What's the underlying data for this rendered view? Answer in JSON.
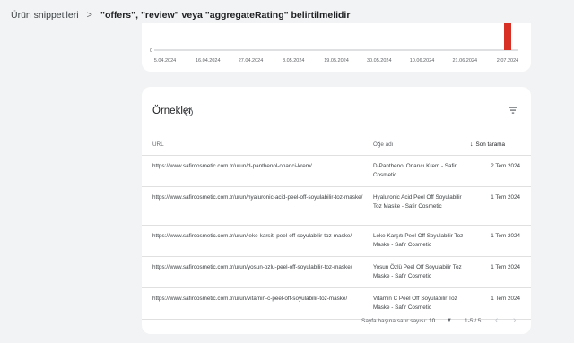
{
  "breadcrumb": {
    "parent": "Ürün snippet'leri",
    "separator": ">",
    "current": "\"offers\", \"review\" veya \"aggregateRating\" belirtilmelidir"
  },
  "chart_data": {
    "type": "bar",
    "y_zero_label": "0",
    "x_tick_labels": [
      "5.04.2024",
      "16.04.2024",
      "27.04.2024",
      "8.05.2024",
      "19.05.2024",
      "30.05.2024",
      "10.06.2024",
      "21.06.2024",
      "2.07.2024"
    ],
    "categories_note_removed": true,
    "bars": [
      {
        "x": "2.07.2024",
        "value": 5
      }
    ],
    "ylim": [
      0,
      5
    ],
    "bar_color": "#d93025",
    "grid": false
  },
  "examples": {
    "title": "Örnekler",
    "help_icon": "help-circle-icon",
    "filter_icon": "filter-icon",
    "columns": {
      "url": "URL",
      "item_name": "Öğe adı",
      "last_crawl": "Son tarama"
    },
    "sort_icon": "arrow-down-icon",
    "rows": [
      {
        "url": "https://www.safircosmetic.com.tr/urun/d-panthenol-onarici-krem/",
        "name": "D-Panthenol Onarıcı Krem - Safir Cosmetic",
        "date": "2 Tem 2024"
      },
      {
        "url": "https://www.safircosmetic.com.tr/urun/hyaluronic-acid-peel-off-soyulabilir-toz-maske/",
        "name": "Hyaluronic Acid Peel Off Soyulabilir Toz Maske - Safir Cosmetic",
        "date": "1 Tem 2024"
      },
      {
        "url": "https://www.safircosmetic.com.tr/urun/leke-karsiti-peel-off-soyulabilir-toz-maske/",
        "name": "Leke Karşıtı Peel Off Soyulabilir Toz Maske - Safir Cosmetic",
        "date": "1 Tem 2024"
      },
      {
        "url": "https://www.safircosmetic.com.tr/urun/yosun-ozlu-peel-off-soyulabilir-toz-maske/",
        "name": "Yosun Özlü Peel Off Soyulabilir Toz Maske - Safir Cosmetic",
        "date": "1 Tem 2024"
      },
      {
        "url": "https://www.safircosmetic.com.tr/urun/vitamin-c-peel-off-soyulabilir-toz-maske/",
        "name": "Vitamin C Peel Off Soyulabilir Toz Maske - Safir Cosmetic",
        "date": "1 Tem 2024"
      }
    ],
    "pagination": {
      "rows_per_page_label": "Sayfa başına satır sayısı:",
      "rows_per_page_value": "10",
      "range": "1-5 / 5",
      "prev_icon": "chevron-left-icon",
      "next_icon": "chevron-right-icon"
    }
  }
}
